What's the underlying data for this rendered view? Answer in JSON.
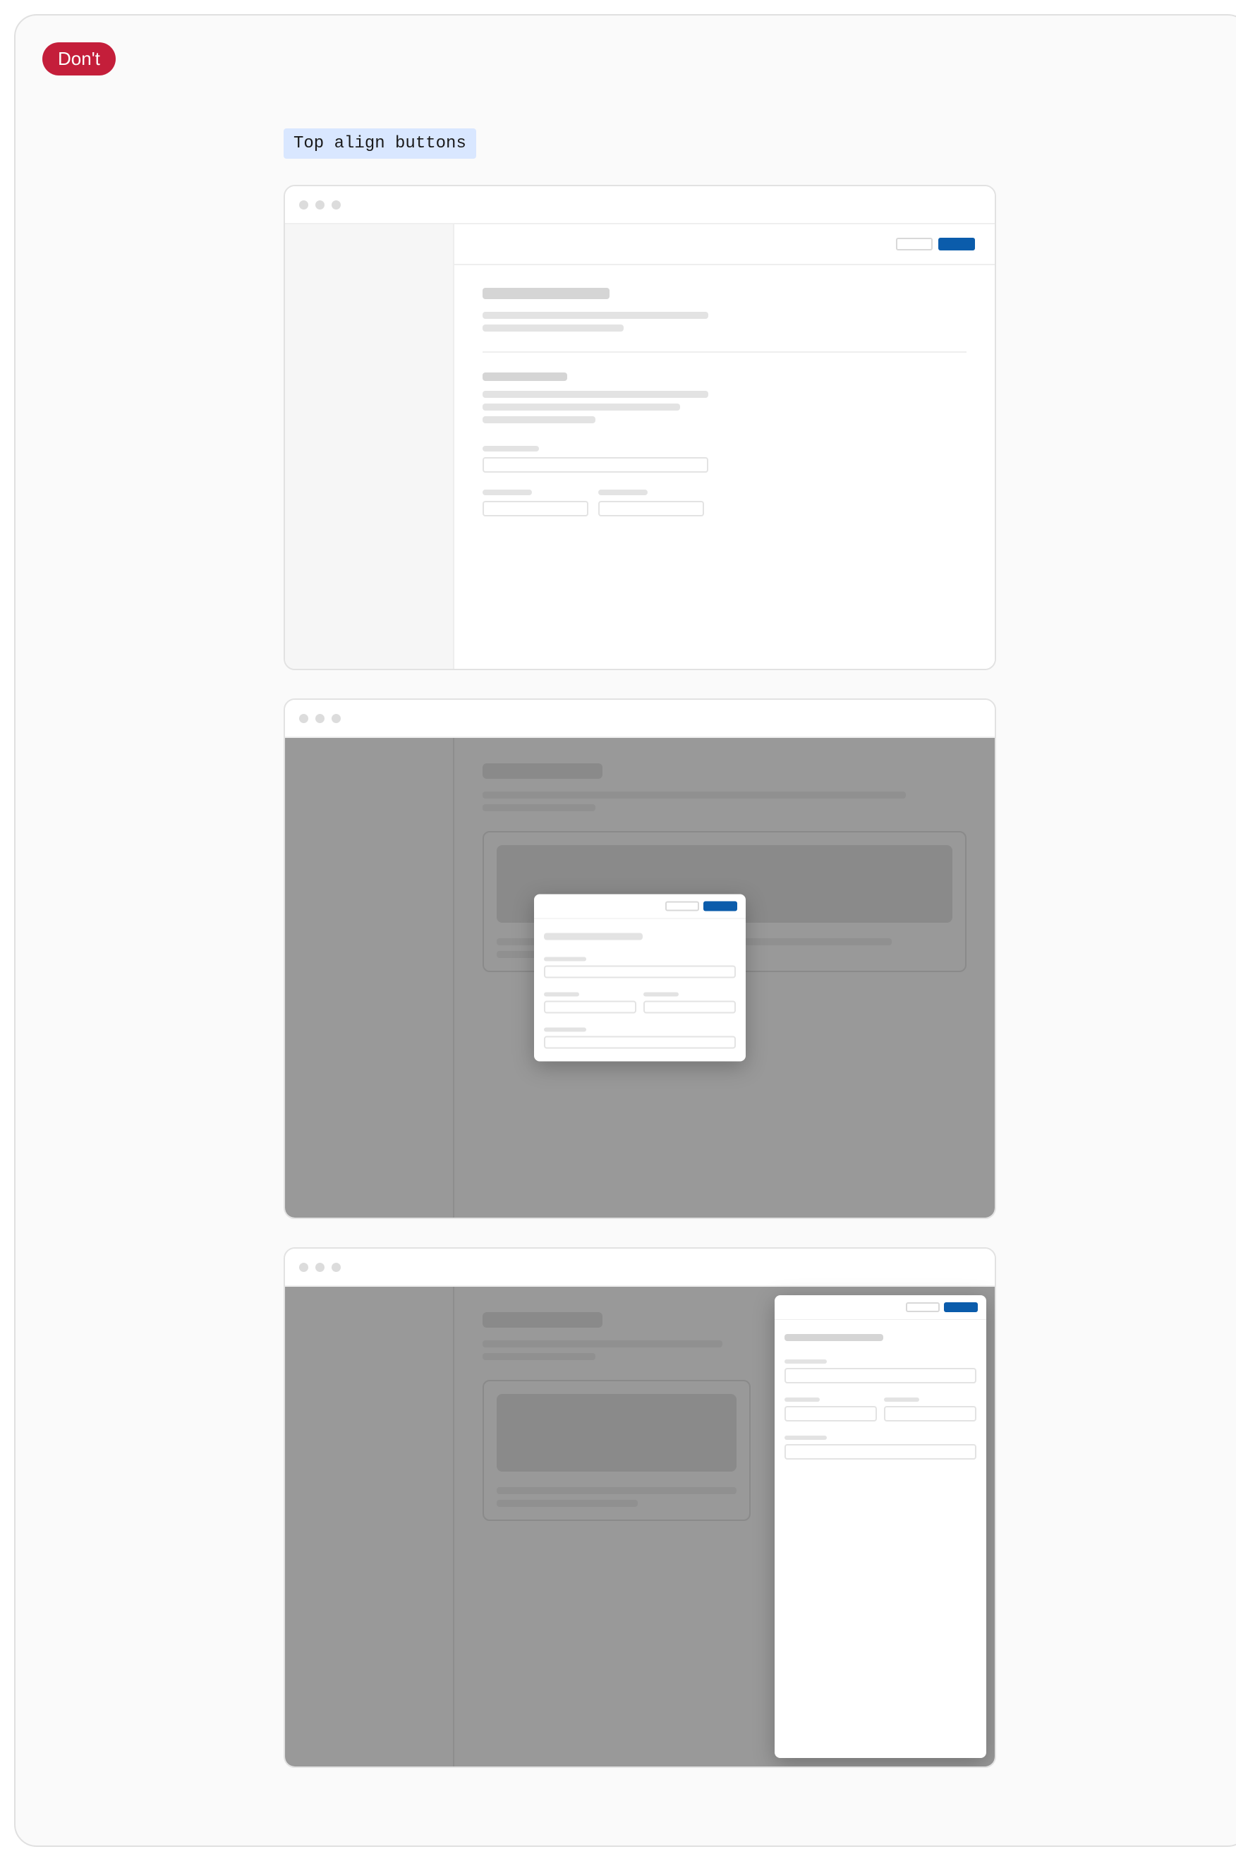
{
  "badge": {
    "label": "Don't"
  },
  "caption": "Top align buttons",
  "examples": {
    "page": {
      "description": "Full-page layout with action buttons top-aligned in header toolbar"
    },
    "modal": {
      "description": "Modal dialog with action buttons top-aligned in modal header"
    },
    "drawer": {
      "description": "Side drawer with action buttons top-aligned in drawer header"
    }
  },
  "colors": {
    "badge_bg": "#c41e3a",
    "caption_bg": "#d9e7ff",
    "primary_button": "#0b5cab"
  }
}
